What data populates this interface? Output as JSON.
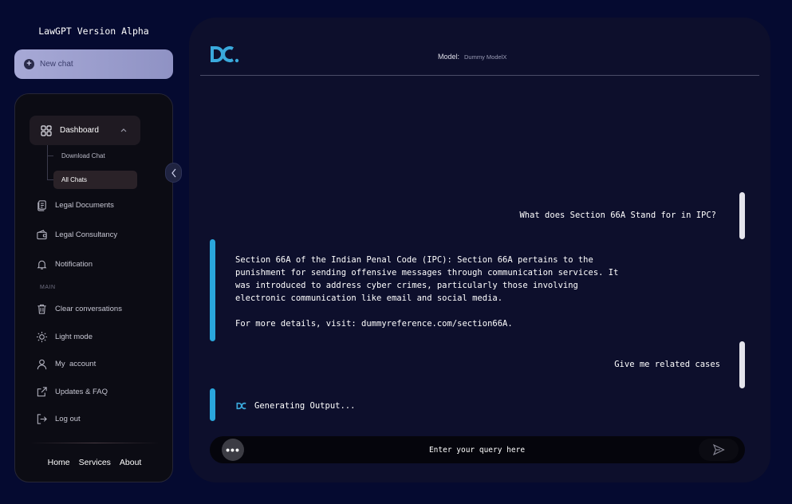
{
  "app": {
    "title": "LawGPT Version Alpha"
  },
  "new_chat": {
    "label": "New chat",
    "icon": "plus-circle-icon"
  },
  "sidebar": {
    "dashboard": {
      "label": "Dashboard",
      "icon": "grid-icon"
    },
    "sub_items": [
      {
        "label": "Download Chat"
      },
      {
        "label": "All Chats",
        "active": true
      }
    ],
    "items": [
      {
        "label": "Legal Documents",
        "icon": "document-icon"
      },
      {
        "label": "Legal Consultancy",
        "icon": "wallet-icon"
      },
      {
        "label": "Notification",
        "icon": "bell-icon"
      }
    ],
    "section_label": "MAIN",
    "main_items": [
      {
        "label": "Clear conversations",
        "icon": "trash-icon"
      },
      {
        "label": "Light mode",
        "icon": "sun-icon"
      },
      {
        "label": "My  account",
        "icon": "user-icon"
      },
      {
        "label": "Updates & FAQ",
        "icon": "external-link-icon"
      },
      {
        "label": "Log out",
        "icon": "logout-icon"
      }
    ],
    "footer_links": [
      "Home",
      "Services",
      "About"
    ]
  },
  "header": {
    "model_label": "Model:",
    "model_value": "Dummy ModelX",
    "logo": "DC"
  },
  "messages": [
    {
      "role": "user",
      "text": "What does Section 66A Stand for in IPC?"
    },
    {
      "role": "assistant",
      "text": "Section 66A of the Indian Penal Code (IPC): Section 66A pertains to the\npunishment for sending offensive messages through communication services. It\nwas introduced to address cyber crimes, particularly those involving\nelectronic communication like email and social media.\n\nFor more details, visit: dummyreference.com/section66A."
    },
    {
      "role": "user",
      "text": "Give me related cases"
    },
    {
      "role": "assistant",
      "status": "Generating Output..."
    }
  ],
  "input": {
    "placeholder": "Enter your query here",
    "more_label": "•••"
  },
  "colors": {
    "accent": "#2aa6dc",
    "background": "#050a30",
    "panel": "#0d0f2c",
    "new_chat": "#a7a9d6"
  }
}
